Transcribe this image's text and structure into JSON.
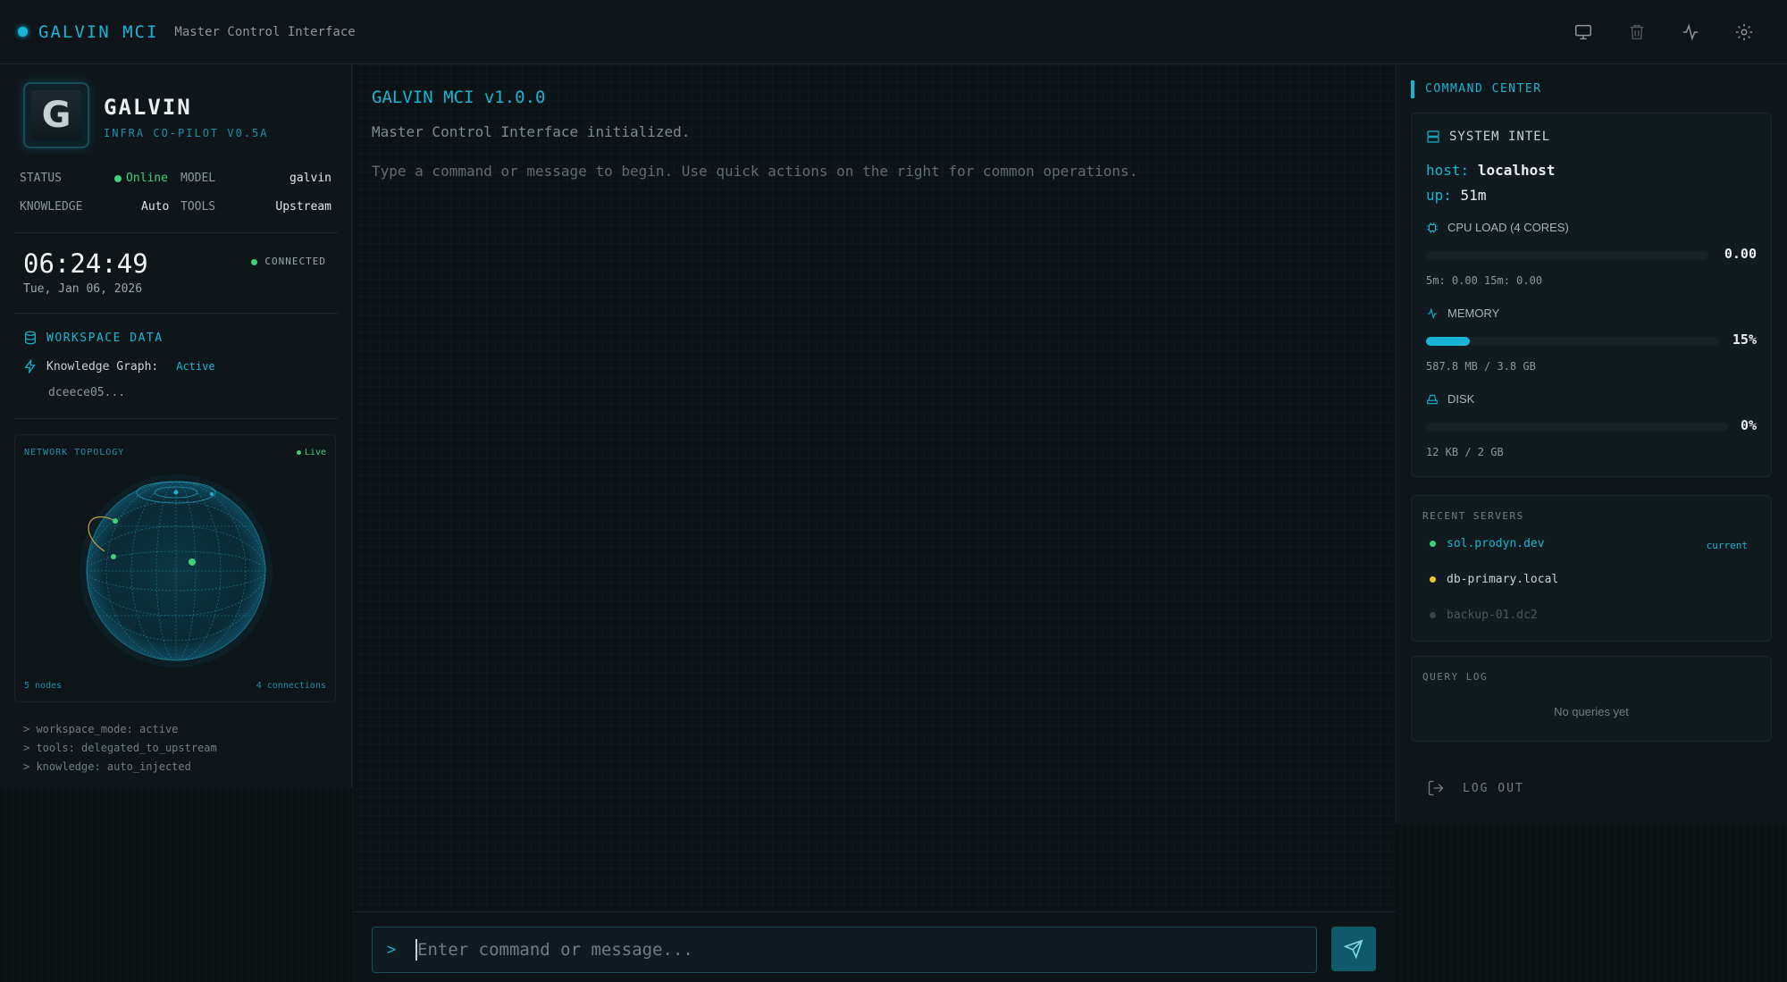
{
  "header": {
    "title": "GALVIN MCI",
    "subtitle": "Master Control Interface",
    "icons": [
      "monitor-icon",
      "trash-icon",
      "activity-icon",
      "settings-icon"
    ]
  },
  "agent": {
    "avatar_letter": "G",
    "name": "GALVIN",
    "subtitle": "INFRA CO-PILOT V0.5A",
    "status_label": "STATUS",
    "status_value": "Online",
    "model_label": "MODEL",
    "model_value": "galvin",
    "knowledge_label": "KNOWLEDGE",
    "knowledge_value": "Auto",
    "tools_label": "TOOLS",
    "tools_value": "Upstream"
  },
  "clock": {
    "time": "06:24:49",
    "date": "Tue, Jan 06, 2026",
    "connection": "CONNECTED"
  },
  "workspace": {
    "title": "WORKSPACE DATA",
    "kg_label": "Knowledge Graph:",
    "kg_status": "Active",
    "hash": "dceece05..."
  },
  "topology": {
    "title": "NETWORK TOPOLOGY",
    "live": "Live",
    "nodes": "5 nodes",
    "connections": "4 connections"
  },
  "logs": [
    "> workspace_mode: active",
    "> tools: delegated_to_upstream",
    "> knowledge: auto_injected"
  ],
  "chat": {
    "title": "GALVIN MCI v1.0.0",
    "line1": "Master Control Interface initialized.",
    "line2": "Type a command or message to begin. Use quick actions on the right for common operations.",
    "prompt": ">",
    "placeholder": "Enter command or message..."
  },
  "command_center": {
    "title": "COMMAND CENTER",
    "system_intel": {
      "title": "SYSTEM INTEL",
      "host_label": "host:",
      "host_value": "localhost",
      "up_label": "up:",
      "up_value": "51m",
      "cpu_label": "CPU LOAD (4 CORES)",
      "cpu_value": "0.00",
      "cpu_fraction": 0.0,
      "cpu_detail": "5m: 0.00  15m: 0.00",
      "mem_label": "MEMORY",
      "mem_value": "15%",
      "mem_fraction": 0.15,
      "mem_detail": "587.8 MB / 3.8 GB",
      "disk_label": "DISK",
      "disk_value": "0%",
      "disk_fraction": 0.0,
      "disk_detail": "12 KB / 2 GB"
    },
    "recent_servers": {
      "title": "RECENT SERVERS",
      "items": [
        {
          "name": "sol.prodyn.dev",
          "tag": "current",
          "color": "#3ed17a"
        },
        {
          "name": "db-primary.local",
          "tag": "",
          "color": "#f2c230"
        },
        {
          "name": "backup-01.dc2",
          "tag": "",
          "color": "#3a4448"
        }
      ]
    },
    "query_log": {
      "title": "QUERY LOG",
      "empty": "No queries yet"
    },
    "logout": "LOG OUT"
  },
  "colors": {
    "accent": "#19b4d4",
    "online": "#3ed17a",
    "warning": "#f2c230"
  }
}
